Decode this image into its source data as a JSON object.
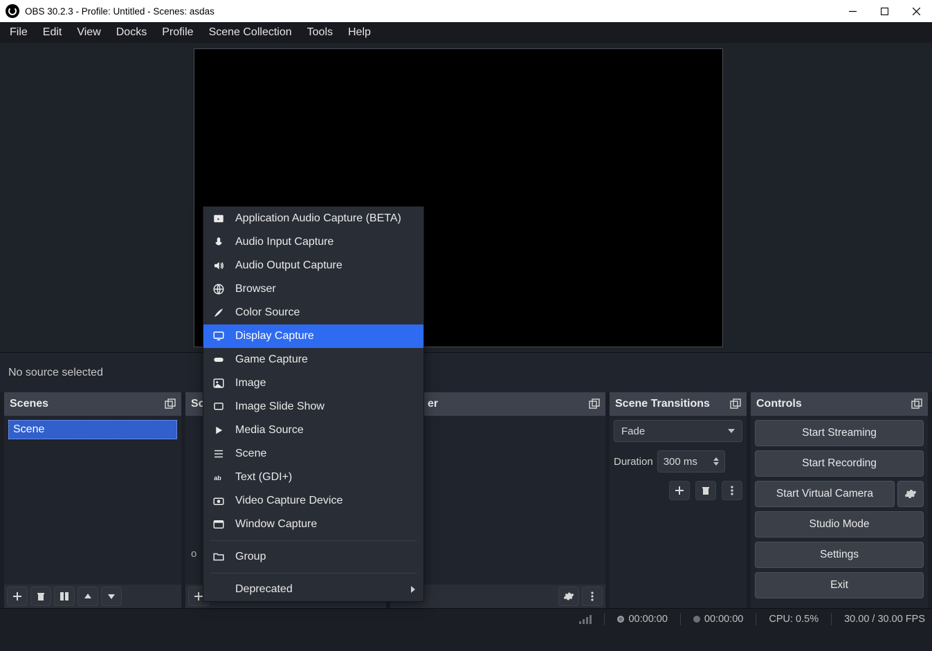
{
  "window": {
    "title": "OBS 30.2.3 - Profile: Untitled - Scenes: asdas"
  },
  "menu": {
    "items": [
      "File",
      "Edit",
      "View",
      "Docks",
      "Profile",
      "Scene Collection",
      "Tools",
      "Help"
    ]
  },
  "strip": {
    "no_source": "No source selected"
  },
  "docks": {
    "scenes": {
      "title": "Scenes",
      "items": [
        "Scene"
      ]
    },
    "sources": {
      "title": "So",
      "truncated_hint": "o"
    },
    "mixer": {
      "title_tail": "er"
    },
    "transitions": {
      "title": "Scene Transitions",
      "selected": "Fade",
      "duration_label": "Duration",
      "duration_value": "300 ms"
    },
    "controls": {
      "title": "Controls",
      "buttons": {
        "start_streaming": "Start Streaming",
        "start_recording": "Start Recording",
        "start_virtual_camera": "Start Virtual Camera",
        "studio_mode": "Studio Mode",
        "settings": "Settings",
        "exit": "Exit"
      }
    }
  },
  "context_menu": {
    "items": [
      {
        "label": "Application Audio Capture (BETA)",
        "icon": "app-audio"
      },
      {
        "label": "Audio Input Capture",
        "icon": "mic"
      },
      {
        "label": "Audio Output Capture",
        "icon": "speaker"
      },
      {
        "label": "Browser",
        "icon": "globe"
      },
      {
        "label": "Color Source",
        "icon": "brush"
      },
      {
        "label": "Display Capture",
        "icon": "monitor",
        "selected": true
      },
      {
        "label": "Game Capture",
        "icon": "gamepad"
      },
      {
        "label": "Image",
        "icon": "image"
      },
      {
        "label": "Image Slide Show",
        "icon": "slideshow"
      },
      {
        "label": "Media Source",
        "icon": "play"
      },
      {
        "label": "Scene",
        "icon": "list"
      },
      {
        "label": "Text (GDI+)",
        "icon": "text"
      },
      {
        "label": "Video Capture Device",
        "icon": "camera"
      },
      {
        "label": "Window Capture",
        "icon": "window"
      }
    ],
    "group": "Group",
    "deprecated": "Deprecated"
  },
  "status": {
    "stream_time": "00:00:00",
    "record_time": "00:00:00",
    "cpu": "CPU: 0.5%",
    "fps": "30.00 / 30.00 FPS"
  }
}
